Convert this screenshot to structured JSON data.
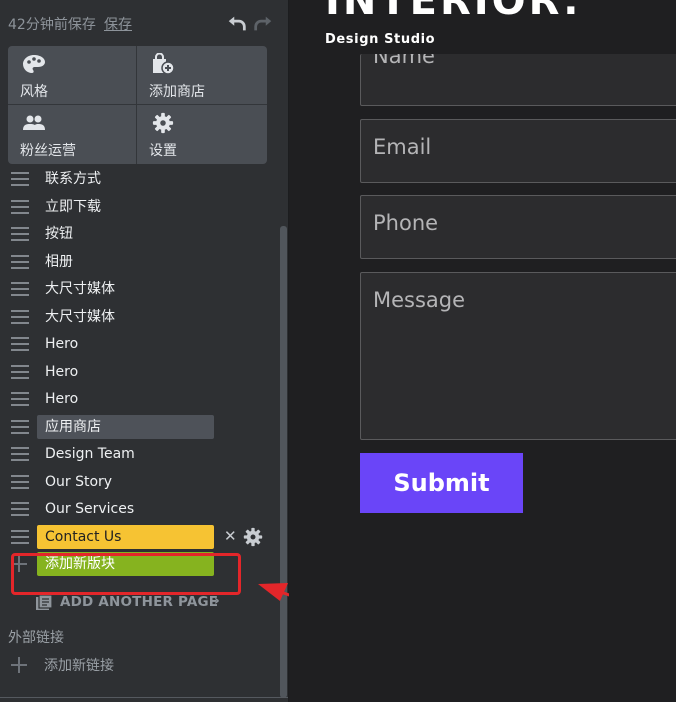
{
  "save_bar": {
    "status": "42分钟前保存",
    "save_label": "保存",
    "undo_icon": "undo-arrow-icon",
    "redo_icon": "redo-arrow-icon"
  },
  "tools": {
    "style": {
      "label": "风格",
      "icon": "palette-icon"
    },
    "store": {
      "label": "添加商店",
      "icon": "shopping-bag-add-icon"
    },
    "fans": {
      "label": "粉丝运营",
      "icon": "users-icon"
    },
    "settings": {
      "label": "设置",
      "icon": "gear-icon"
    }
  },
  "blocks": [
    "联系方式",
    "立即下载",
    "按钮",
    "相册",
    "大尺寸媒体",
    "大尺寸媒体",
    "Hero",
    "Hero",
    "Hero",
    "应用商店",
    "Design Team",
    "Our Story",
    "Our Services",
    "Contact Us"
  ],
  "selected_block": "应用商店",
  "active_block": "Contact Us",
  "add_block_label": "添加新版块",
  "add_page_label": "ADD ANOTHER PAGE",
  "external_links": {
    "title": "外部链接",
    "add_label": "添加新链接"
  },
  "colors": {
    "accent_yellow": "#f6c333",
    "accent_green": "#86b31f",
    "annotation_red": "#e3262a",
    "submit_purple": "#6a45f8"
  },
  "preview": {
    "brand_name": "INTERIOR.",
    "brand_subtitle": "Design Studio",
    "fields": {
      "name_placeholder": "Name",
      "email_placeholder": "Email",
      "phone_placeholder": "Phone",
      "message_placeholder": "Message"
    },
    "submit_label": "Submit"
  }
}
